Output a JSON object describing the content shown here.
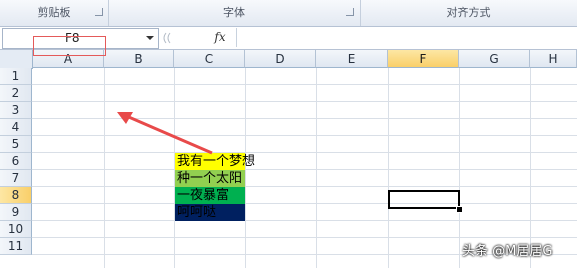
{
  "ribbon": {
    "groups": [
      {
        "label": "剪贴板"
      },
      {
        "label": "字体"
      },
      {
        "label": "对齐方式"
      }
    ]
  },
  "formula_bar": {
    "name_box": "F8",
    "fx_label": "fx",
    "formula": ""
  },
  "sheet": {
    "columns": [
      "A",
      "B",
      "C",
      "D",
      "E",
      "F",
      "G",
      "H"
    ],
    "rows": [
      "1",
      "2",
      "3",
      "4",
      "5",
      "6",
      "7",
      "8",
      "9",
      "10",
      "11"
    ],
    "selected_column": "F",
    "selected_row": "8",
    "cells": [
      {
        "ref": "C6",
        "text": "我有一个梦想",
        "fill": "#ffff00",
        "color": "#000000"
      },
      {
        "ref": "C7",
        "text": "种一个太阳",
        "fill": "#92d050",
        "color": "#000000"
      },
      {
        "ref": "C8",
        "text": "一夜暴富",
        "fill": "#00b050",
        "color": "#000000"
      },
      {
        "ref": "C9",
        "text": "呵呵哒",
        "fill": "#002060",
        "color": "#000000"
      }
    ]
  },
  "annotation": {
    "color": "#e84a4a",
    "highlighted_cell": "A2"
  },
  "watermark": "头条 @M居居G"
}
